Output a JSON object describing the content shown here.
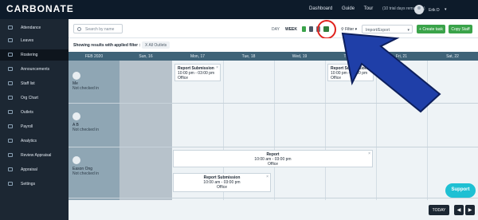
{
  "app": {
    "brand": "CARBONATE"
  },
  "topnav": {
    "dashboard": "Dashboard",
    "guide": "Guide",
    "tour": "Tour",
    "tour_note": "(10 trial days remaining)",
    "user": "Erik D"
  },
  "sidebar": {
    "items": [
      {
        "label": "Attendance",
        "icon": "clock-icon"
      },
      {
        "label": "Leaves",
        "icon": "calendar-icon"
      },
      {
        "label": "Rostering",
        "icon": "roster-icon",
        "active": true
      },
      {
        "label": "Announcements",
        "icon": "megaphone-icon"
      },
      {
        "label": "Staff list",
        "icon": "people-icon"
      },
      {
        "label": "Org Chart",
        "icon": "orgchart-icon"
      },
      {
        "label": "Outlets",
        "icon": "store-icon"
      },
      {
        "label": "Payroll",
        "icon": "money-icon"
      },
      {
        "label": "Analytics",
        "icon": "chart-icon"
      },
      {
        "label": "Review Appraisal",
        "icon": "star-icon"
      },
      {
        "label": "Appraisal",
        "icon": "clipboard-icon"
      },
      {
        "label": "Settings",
        "icon": "gear-icon"
      }
    ]
  },
  "toolbar": {
    "search_placeholder": "Search by name",
    "day": "DAY",
    "week": "WEEK",
    "filter": "Filter",
    "import_export": "Import/Export",
    "create_task": "+ Create task",
    "copy_staff": "Copy Staff",
    "colors": {
      "green": "#3aa34a",
      "red_circle": "#e0211c",
      "arrow": "#1f3fa8"
    }
  },
  "filterrow": {
    "text": "Showing results with applied filter :",
    "chip": "X  All Outlets"
  },
  "calendar": {
    "corner": "FEB 2020",
    "days": [
      "Sun, 16",
      "Mon, 17",
      "Tue, 18",
      "Wed, 19",
      "Thu, 20",
      "Fri, 21",
      "Sat, 22"
    ],
    "employees": [
      {
        "name": "Me",
        "status": "Not checked in"
      },
      {
        "name": "A B",
        "status": "Not checked in"
      },
      {
        "name": "Eason Ong",
        "status": "Not checked in"
      }
    ],
    "shifts": {
      "s1": {
        "title": "Report Submission",
        "time": "10:00 pm - 03:00 pm",
        "place": "Office"
      },
      "s2": {
        "title": "Report Submission",
        "time": "10:00 pm - 03:00 pm",
        "place": "Office"
      },
      "s3": {
        "title": "Report",
        "time": "10:00 am - 03:00 pm",
        "place": "Office"
      },
      "s4": {
        "title": "Report Submission",
        "time": "10:00 am - 03:00 pm",
        "place": "Office"
      }
    }
  },
  "bottom": {
    "today": "TODAY",
    "prev": "◀",
    "next": "▶"
  },
  "support": "Support"
}
